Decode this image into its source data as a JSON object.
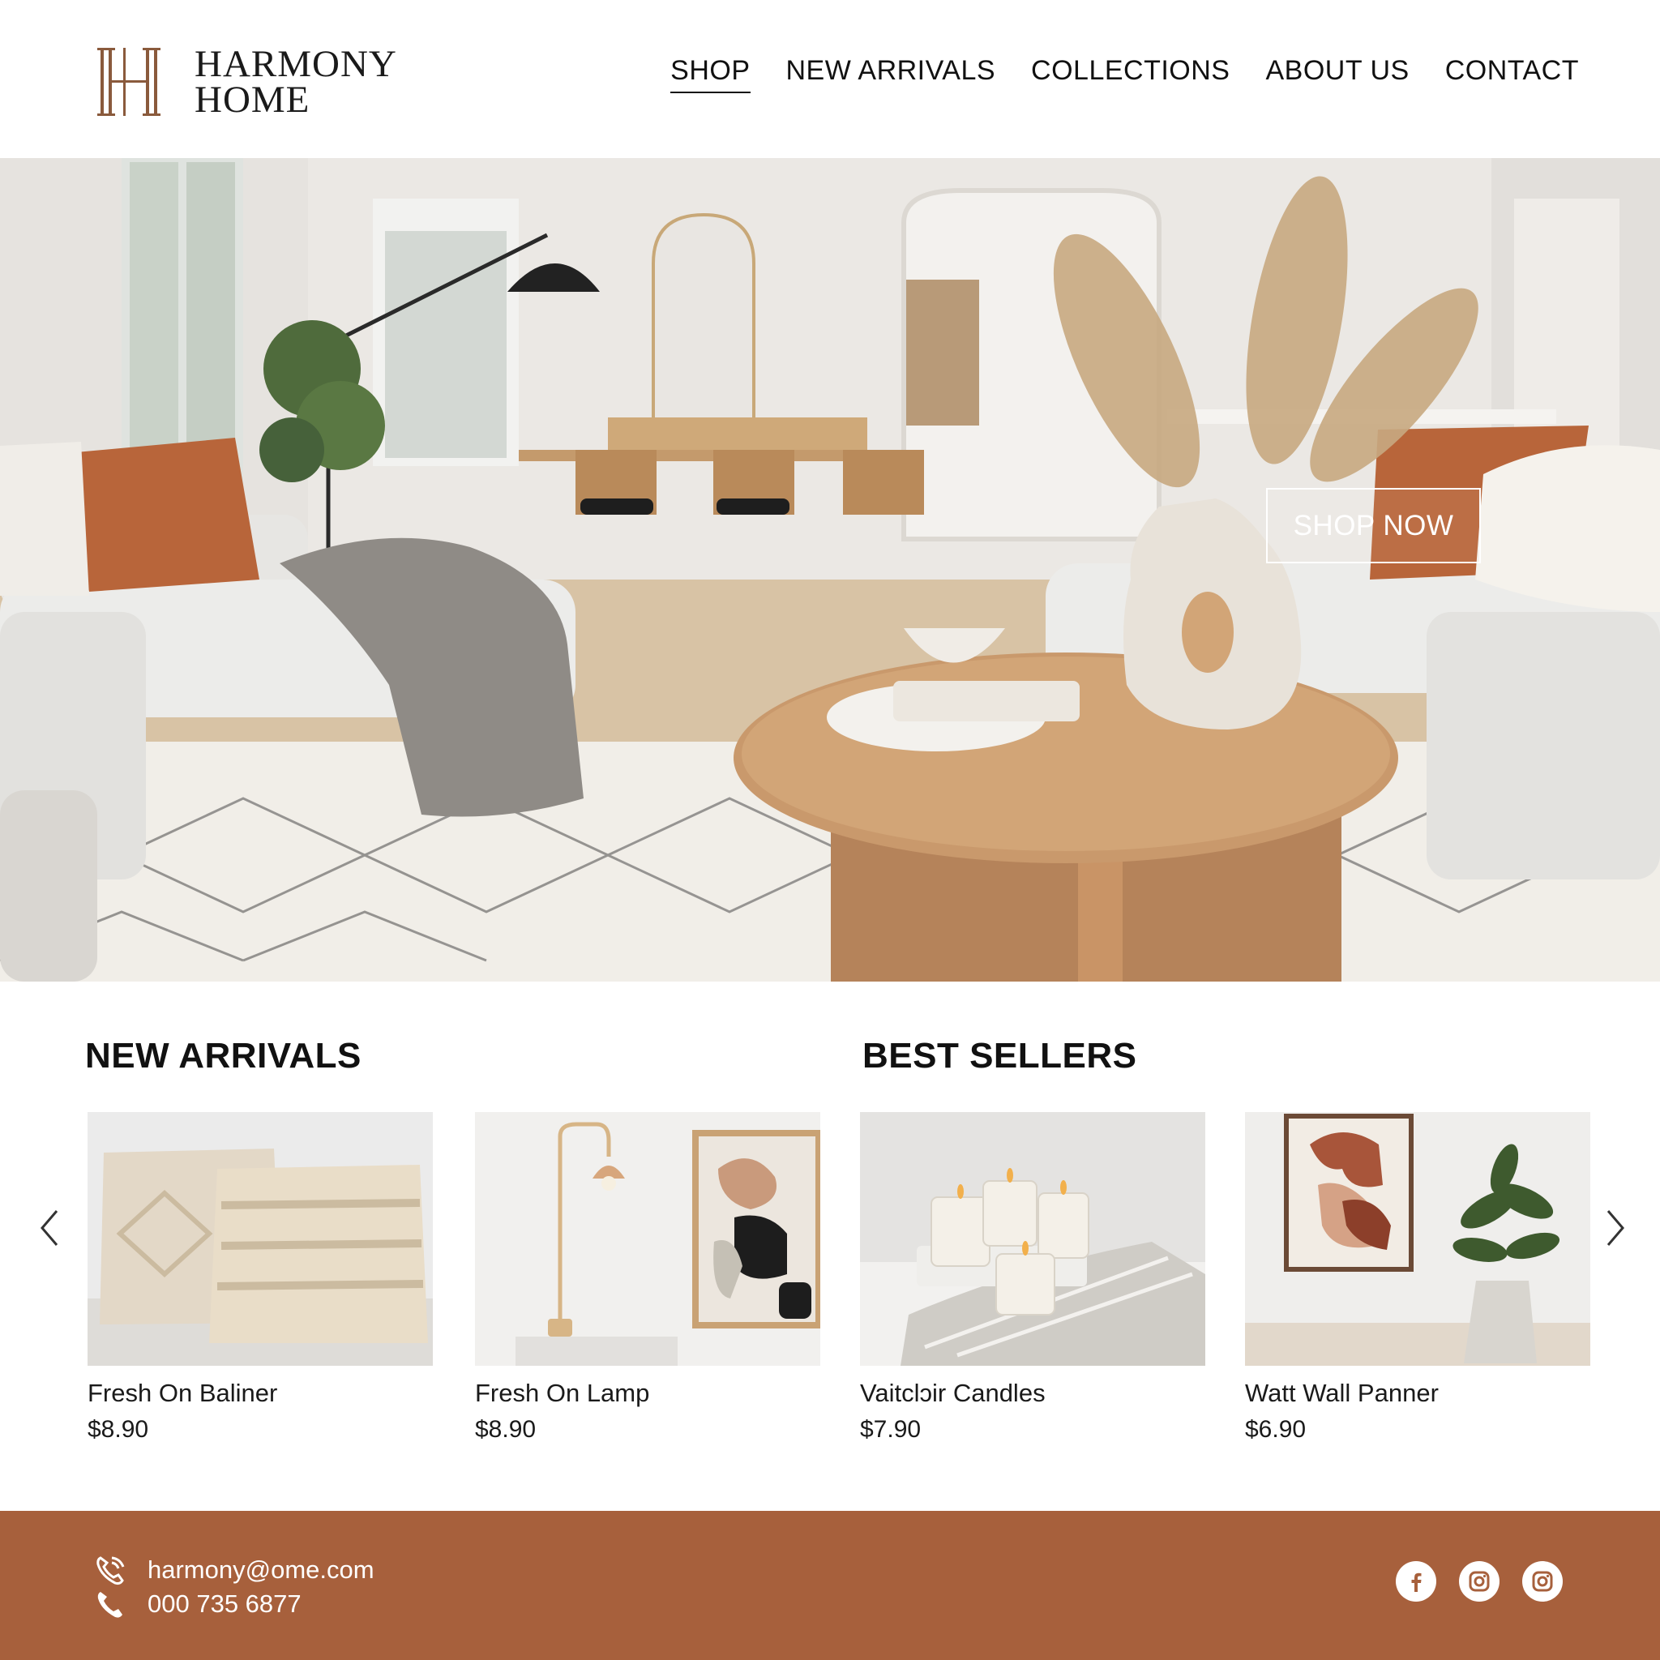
{
  "brand": {
    "line1": "HARMONY",
    "line2": "HOME"
  },
  "nav": {
    "items": [
      {
        "label": "SHOP",
        "active": true
      },
      {
        "label": "NEW ARRIVALS",
        "active": false
      },
      {
        "label": "COLLECTIONS",
        "active": false
      },
      {
        "label": "ABOUT US",
        "active": false
      },
      {
        "label": "CONTACT",
        "active": false
      }
    ]
  },
  "hero": {
    "cta_label": "SHOP NOW"
  },
  "sections": {
    "new_arrivals": "NEW ARRIVALS",
    "best_sellers": "BEST SELLERS"
  },
  "products": [
    {
      "name": "Fresh On Baliner",
      "price": "$8.90"
    },
    {
      "name": "Fresh On Lamp",
      "price": "$8.90"
    },
    {
      "name": "Vaitclɔir Candles",
      "price": "$7.90"
    },
    {
      "name": "Watt Wall Panner",
      "price": "$6.90"
    }
  ],
  "footer": {
    "email": "harmony@ome.com",
    "phone": "000 735 6877",
    "social_icons": [
      "facebook-icon",
      "instagram-icon",
      "instagram-icon"
    ]
  },
  "colors": {
    "accent": "#a7603c",
    "logo": "#8a5a3c",
    "text": "#111111",
    "background": "#ffffff"
  }
}
